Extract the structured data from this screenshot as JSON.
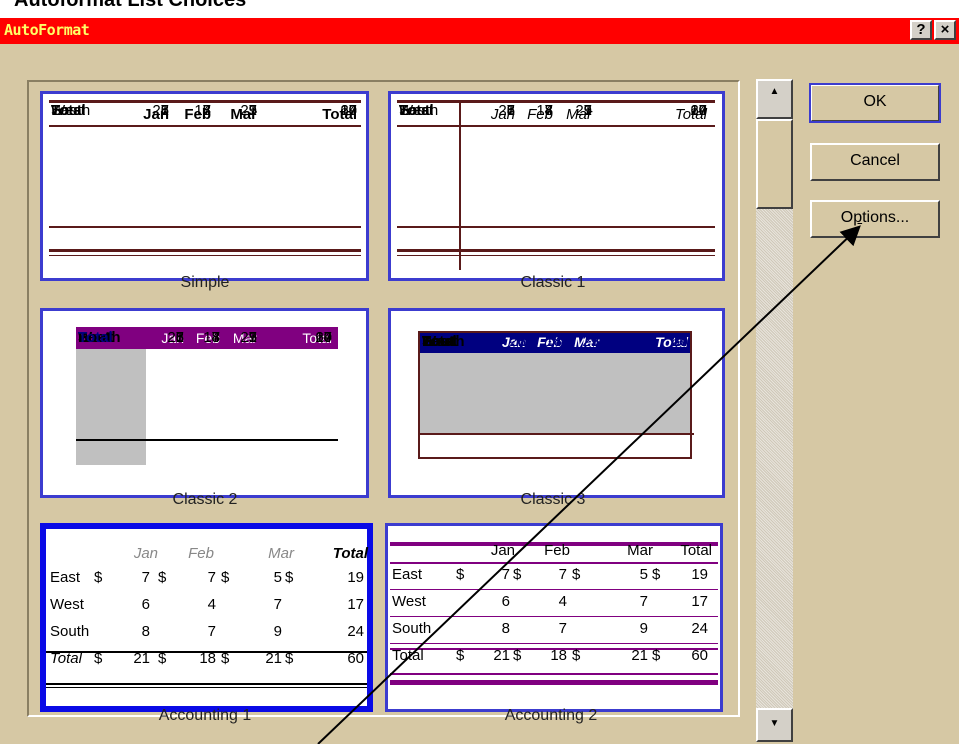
{
  "caption": "Autoformat List Choices",
  "window": {
    "title": "AutoFormat",
    "help_label": "?",
    "close_label": "×"
  },
  "buttons": {
    "ok": "OK",
    "cancel": "Cancel",
    "options_prefix": "O",
    "options_underline": "p",
    "options_suffix": "tions..."
  },
  "scroll": {
    "up": "▲",
    "down": "▼"
  },
  "formats": [
    {
      "name": "Simple",
      "header": [
        "",
        "Jan",
        "Feb",
        "Mar",
        "Total"
      ],
      "rows": [
        [
          "East",
          "7",
          "7",
          "5",
          "19"
        ],
        [
          "West",
          "6",
          "4",
          "7",
          "17"
        ],
        [
          "South",
          "8",
          "7",
          "9",
          "24"
        ],
        [
          "Total",
          "21",
          "18",
          "21",
          "60"
        ]
      ]
    },
    {
      "name": "Classic 1",
      "header": [
        "",
        "Jan",
        "Feb",
        "Mar",
        "Total"
      ],
      "rows": [
        [
          "East",
          "7",
          "7",
          "5",
          "19"
        ],
        [
          "West",
          "6",
          "4",
          "7",
          "17"
        ],
        [
          "South",
          "8",
          "7",
          "9",
          "24"
        ],
        [
          "Total",
          "21",
          "18",
          "21",
          "60"
        ]
      ]
    },
    {
      "name": "Classic 2",
      "header": [
        "",
        "Jan",
        "Feb",
        "Mar",
        "Total"
      ],
      "rows": [
        [
          "East",
          "7",
          "7",
          "5",
          "19"
        ],
        [
          "West",
          "6",
          "4",
          "7",
          "17"
        ],
        [
          "South",
          "8",
          "7",
          "9",
          "24"
        ],
        [
          "Total",
          "21",
          "18",
          "21",
          "60"
        ]
      ]
    },
    {
      "name": "Classic 3",
      "header": [
        "",
        "Jan",
        "Feb",
        "Mar",
        "Total"
      ],
      "rows": [
        [
          "East",
          "7",
          "7",
          "5",
          "19"
        ],
        [
          "West",
          "6",
          "4",
          "7",
          "17"
        ],
        [
          "South",
          "8",
          "7",
          "9",
          "24"
        ],
        [
          "Total",
          "21",
          "18",
          "21",
          "60"
        ]
      ]
    },
    {
      "name": "Accounting 1",
      "header": [
        "",
        "Jan",
        "Feb",
        "Mar",
        "Total"
      ],
      "rows": [
        [
          "East",
          "$",
          "7",
          "$",
          "7",
          "$",
          "5",
          "$",
          "19"
        ],
        [
          "West",
          "",
          "6",
          "",
          "4",
          "",
          "7",
          "",
          "17"
        ],
        [
          "South",
          "",
          "8",
          "",
          "7",
          "",
          "9",
          "",
          "24"
        ],
        [
          "Total",
          "$",
          "21",
          "$",
          "18",
          "$",
          "21",
          "$",
          "60"
        ]
      ]
    },
    {
      "name": "Accounting 2",
      "header": [
        "",
        "Jan",
        "Feb",
        "Mar",
        "Total"
      ],
      "rows": [
        [
          "East",
          "$",
          "7",
          "$",
          "7",
          "$",
          "5",
          "$",
          "19"
        ],
        [
          "West",
          "",
          "6",
          "",
          "4",
          "",
          "7",
          "",
          "17"
        ],
        [
          "South",
          "",
          "8",
          "",
          "7",
          "",
          "9",
          "",
          "24"
        ],
        [
          "Total",
          "$",
          "21",
          "$",
          "18",
          "$",
          "21",
          "$",
          "60"
        ]
      ]
    }
  ],
  "colors": {
    "title_bar": "#ff0000",
    "title_text": "#ffff66",
    "dialog": "#d6c8a4",
    "classic2_header": "#800080",
    "classic3_header": "#000080",
    "selected_border": "#0a0ae6"
  }
}
